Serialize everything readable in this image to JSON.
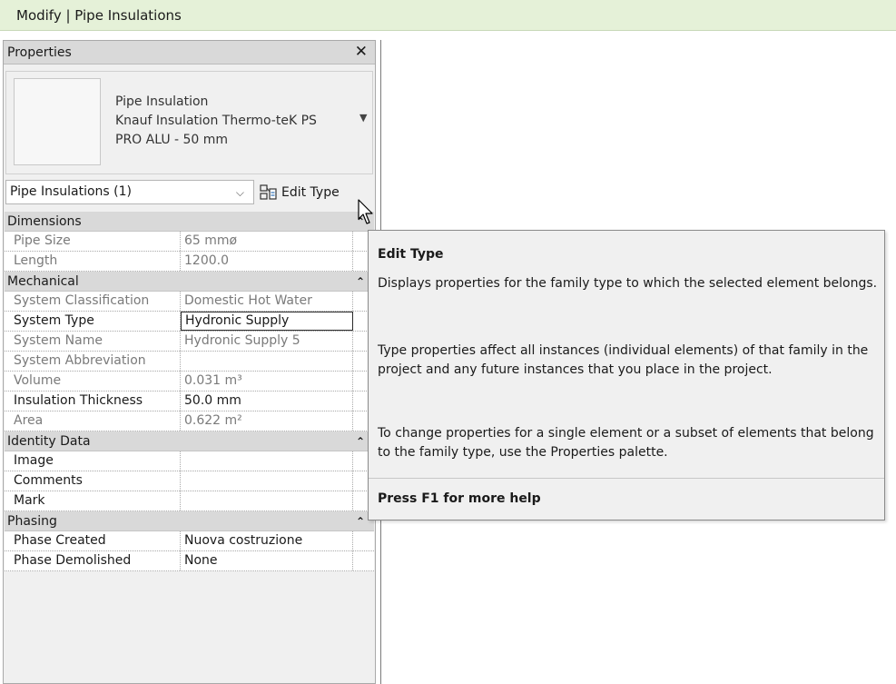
{
  "ribbon": {
    "title": "Modify | Pipe Insulations"
  },
  "properties": {
    "header": "Properties",
    "close_glyph": "✕",
    "type_selector": {
      "line1": "Pipe Insulation",
      "line2": "Knauf Insulation Thermo-teK PS",
      "line3": "PRO ALU - 50 mm",
      "arrow": "▼"
    },
    "instance_filter": {
      "value": "Pipe Insulations (1)",
      "caret": "⌵"
    },
    "edit_type_label": "Edit Type",
    "groups": [
      {
        "label": "Dimensions",
        "collapse": "⌃⌃"
      },
      {
        "label": "Mechanical",
        "collapse": "⌃⌃"
      },
      {
        "label": "Identity Data",
        "collapse": "⌃⌃"
      },
      {
        "label": "Phasing",
        "collapse": "⌃⌃"
      }
    ],
    "dimensions": [
      {
        "name": "Pipe Size",
        "value": "65 mmø"
      },
      {
        "name": "Length",
        "value": "1200.0"
      }
    ],
    "mechanical": [
      {
        "name": "System Classification",
        "value": "Domestic Hot Water"
      },
      {
        "name": "System Type",
        "value": "Hydronic Supply"
      },
      {
        "name": "System Name",
        "value": "Hydronic Supply 5"
      },
      {
        "name": "System Abbreviation",
        "value": ""
      },
      {
        "name": "Volume",
        "value": "0.031 m³"
      },
      {
        "name": "Insulation Thickness",
        "value": "50.0 mm"
      },
      {
        "name": "Area",
        "value": "0.622 m²"
      }
    ],
    "identity": [
      {
        "name": "Image",
        "value": ""
      },
      {
        "name": "Comments",
        "value": ""
      },
      {
        "name": "Mark",
        "value": ""
      }
    ],
    "phasing": [
      {
        "name": "Phase Created",
        "value": "Nuova costruzione"
      },
      {
        "name": "Phase Demolished",
        "value": "None"
      }
    ]
  },
  "tooltip": {
    "title": "Edit Type",
    "p1": "Displays properties for the family type to which the selected element belongs.",
    "p2": "Type properties affect all instances (individual elements) of that family in the project and any future instances that you place in the project.",
    "p3": "To change properties for a single element or a subset of elements that belong to the family type, use the Properties palette.",
    "help": "Press F1 for more help"
  },
  "colors": {
    "ribbon_bg": "#e5f1d8",
    "group_bg": "#d9d9d9",
    "readonly_text": "#7a7a7a"
  },
  "icons": [
    "close-icon",
    "dropdown-arrow-icon",
    "edit-type-icon",
    "collapse-chevron-icon",
    "mouse-cursor-icon"
  ]
}
